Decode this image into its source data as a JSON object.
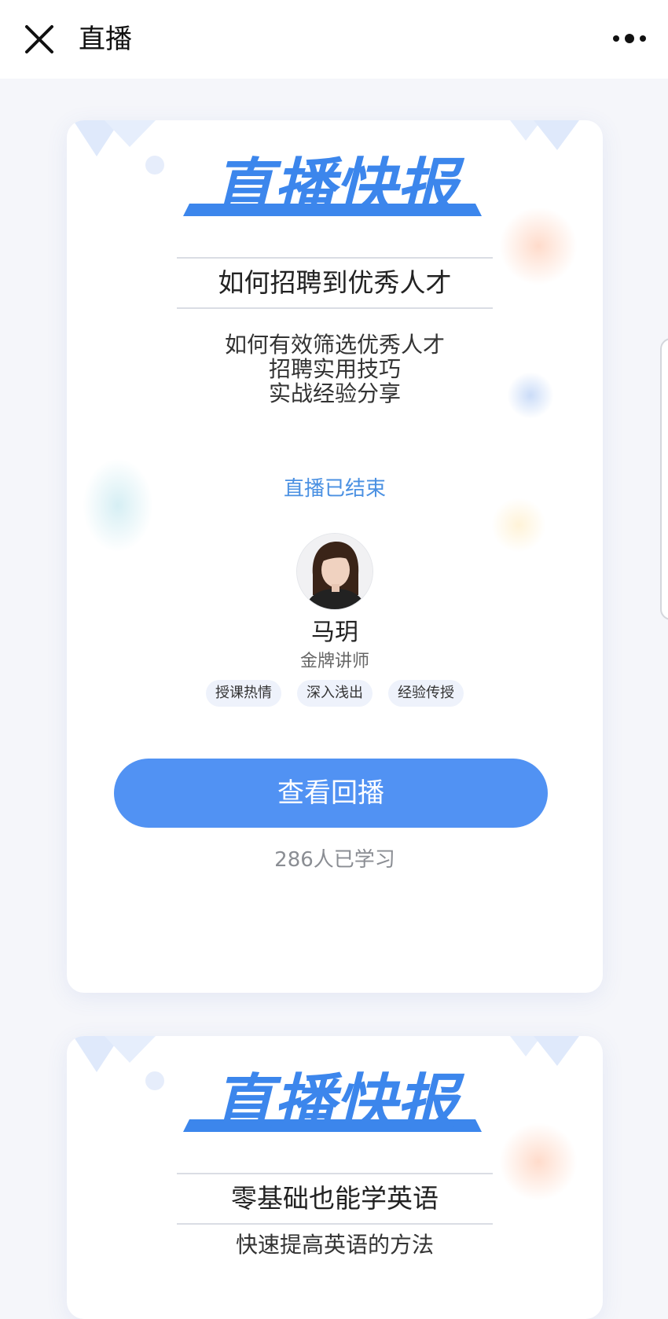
{
  "topbar": {
    "title": "直播",
    "close_icon": "close-icon",
    "more_icon": "more-icon"
  },
  "cards": [
    {
      "banner": "直播快报",
      "topic": "如何招聘到优秀人才",
      "subtitles": [
        "如何有效筛选优秀人才",
        "招聘实用技巧",
        "实战经验分享"
      ],
      "status": "直播已结束",
      "teacher": {
        "name": "马玥",
        "title": "金牌讲师",
        "avatar_icon": "avatar-photo"
      },
      "tags": [
        "授课热情",
        "深入浅出",
        "经验传授"
      ],
      "action_label": "查看回播",
      "learners": "286人已学习"
    },
    {
      "banner": "直播快报",
      "topic": "零基础也能学英语",
      "subtitles": [
        "快速提高英语的方法"
      ]
    }
  ],
  "colors": {
    "accent": "#4a90e2",
    "button": "#5192f3",
    "banner": "#3c86ec"
  }
}
